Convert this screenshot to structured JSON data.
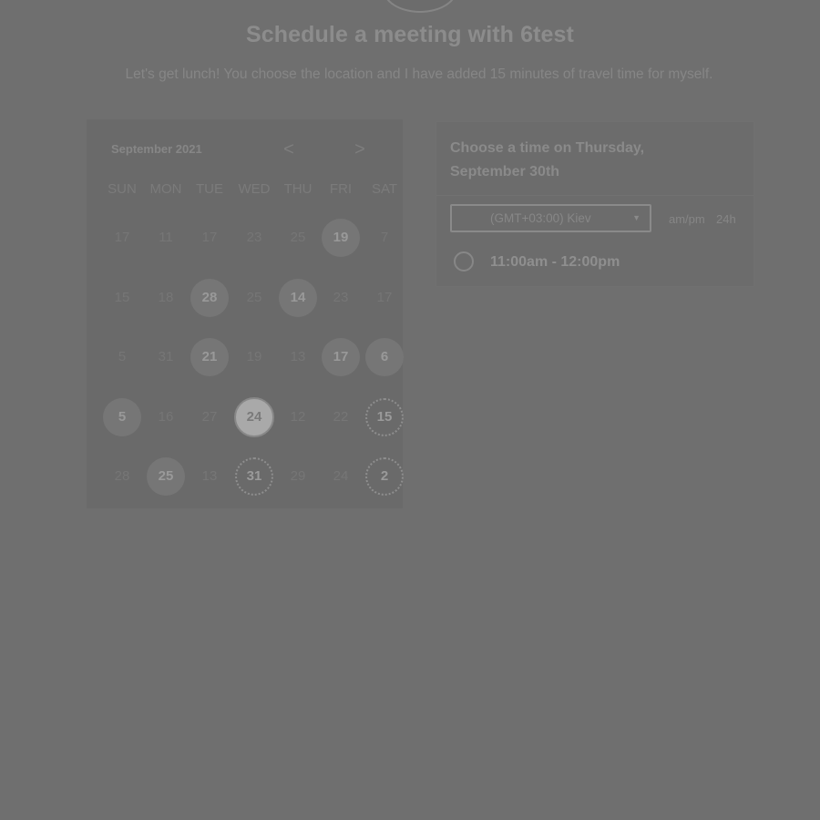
{
  "header": {
    "title": "Schedule a meeting with 6test",
    "subtitle": "Let's get lunch! You choose the location and I have added 15 minutes of travel time for myself."
  },
  "calendar": {
    "month": "September 2021",
    "prev_icon": "<",
    "next_icon": ">",
    "weekdays": [
      "SUN",
      "MON",
      "TUE",
      "WED",
      "THU",
      "FRI",
      "SAT"
    ],
    "weeks": [
      [
        {
          "d": "17",
          "s": "muted"
        },
        {
          "d": "11",
          "s": "muted"
        },
        {
          "d": "17",
          "s": "muted"
        },
        {
          "d": "23",
          "s": "muted"
        },
        {
          "d": "25",
          "s": "muted"
        },
        {
          "d": "19",
          "s": "avail"
        },
        {
          "d": "7",
          "s": "muted"
        }
      ],
      [
        {
          "d": "15",
          "s": "muted"
        },
        {
          "d": "18",
          "s": "muted"
        },
        {
          "d": "28",
          "s": "avail"
        },
        {
          "d": "25",
          "s": "muted"
        },
        {
          "d": "14",
          "s": "avail"
        },
        {
          "d": "23",
          "s": "muted"
        },
        {
          "d": "17",
          "s": "muted"
        }
      ],
      [
        {
          "d": "5",
          "s": "muted"
        },
        {
          "d": "31",
          "s": "muted"
        },
        {
          "d": "21",
          "s": "avail"
        },
        {
          "d": "19",
          "s": "muted"
        },
        {
          "d": "13",
          "s": "muted"
        },
        {
          "d": "17",
          "s": "avail"
        },
        {
          "d": "6",
          "s": "avail"
        }
      ],
      [
        {
          "d": "5",
          "s": "avail"
        },
        {
          "d": "16",
          "s": "muted"
        },
        {
          "d": "27",
          "s": "muted"
        },
        {
          "d": "24",
          "s": "selected"
        },
        {
          "d": "12",
          "s": "muted"
        },
        {
          "d": "22",
          "s": "muted"
        },
        {
          "d": "15",
          "s": "dotted"
        }
      ],
      [
        {
          "d": "28",
          "s": "muted"
        },
        {
          "d": "25",
          "s": "avail"
        },
        {
          "d": "13",
          "s": "muted"
        },
        {
          "d": "31",
          "s": "dotted"
        },
        {
          "d": "29",
          "s": "muted"
        },
        {
          "d": "24",
          "s": "muted"
        },
        {
          "d": "2",
          "s": "dotted"
        }
      ]
    ]
  },
  "times": {
    "heading": "Choose a time on Thursday, September 30th",
    "timezone": "(GMT+03:00) Kiev",
    "format_ampm": "am/pm",
    "format_24h": "24h",
    "slots": [
      "11:00am - 12:00pm"
    ]
  }
}
